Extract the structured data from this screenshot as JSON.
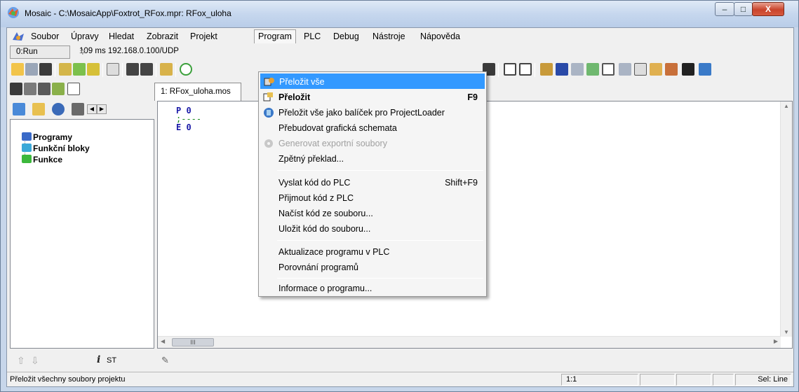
{
  "window": {
    "title": "Mosaic - C:\\MosaicApp\\Foxtrot_RFox.mpr: RFox_uloha",
    "minimize_label": "–",
    "maximize_label": "□",
    "close_label": "X"
  },
  "menubar": {
    "items": [
      "Soubor",
      "Úpravy",
      "Hledat",
      "Zobrazit",
      "Projekt",
      "Program",
      "PLC",
      "Debug",
      "Nástroje",
      "Nápověda"
    ],
    "open_item": "Program"
  },
  "status_row": {
    "run_state": "0:Run",
    "connection": "109 ms  192.168.0.100/UDP"
  },
  "editor": {
    "tab_label": "1: RFox_uloha.mos",
    "code_lines": [
      "P  0",
      ";----",
      "E  0"
    ],
    "hscroll_thumb": "III"
  },
  "left_panel": {
    "tree": [
      "Programy",
      "Funkční bloky",
      "Funkce"
    ],
    "footer_label": "ST"
  },
  "program_menu": {
    "items": [
      {
        "label": "Přeložit vše",
        "shortcut": "",
        "state": "highlighted"
      },
      {
        "label": "Přeložit",
        "shortcut": "F9",
        "state": "bold"
      },
      {
        "label": "Přeložit vše jako balíček pro ProjectLoader",
        "shortcut": "",
        "state": "normal"
      },
      {
        "label": "Přebudovat grafická schemata",
        "shortcut": "",
        "state": "normal"
      },
      {
        "label": "Generovat exportní soubory",
        "shortcut": "",
        "state": "disabled"
      },
      {
        "label": "Zpětný překlad...",
        "shortcut": "",
        "state": "normal"
      },
      {
        "label": "Vyslat kód do PLC",
        "shortcut": "Shift+F9",
        "state": "normal"
      },
      {
        "label": "Přijmout kód z PLC",
        "shortcut": "",
        "state": "normal"
      },
      {
        "label": "Načíst kód ze souboru...",
        "shortcut": "",
        "state": "normal"
      },
      {
        "label": "Uložit kód do souboru...",
        "shortcut": "",
        "state": "normal"
      },
      {
        "label": "Aktualizace programu v PLC",
        "shortcut": "",
        "state": "normal"
      },
      {
        "label": "Porovnání programů",
        "shortcut": "",
        "state": "normal"
      },
      {
        "label": "Informace o programu...",
        "shortcut": "",
        "state": "normal"
      }
    ]
  },
  "statusbar": {
    "hint": "Přeložit všechny soubory projektu",
    "position": "1:1",
    "selection": "Sel: Line"
  },
  "colors": {
    "highlight": "#3399ff",
    "menu_bg": "#f5f5f5",
    "chrome": "#f0f0f0"
  }
}
